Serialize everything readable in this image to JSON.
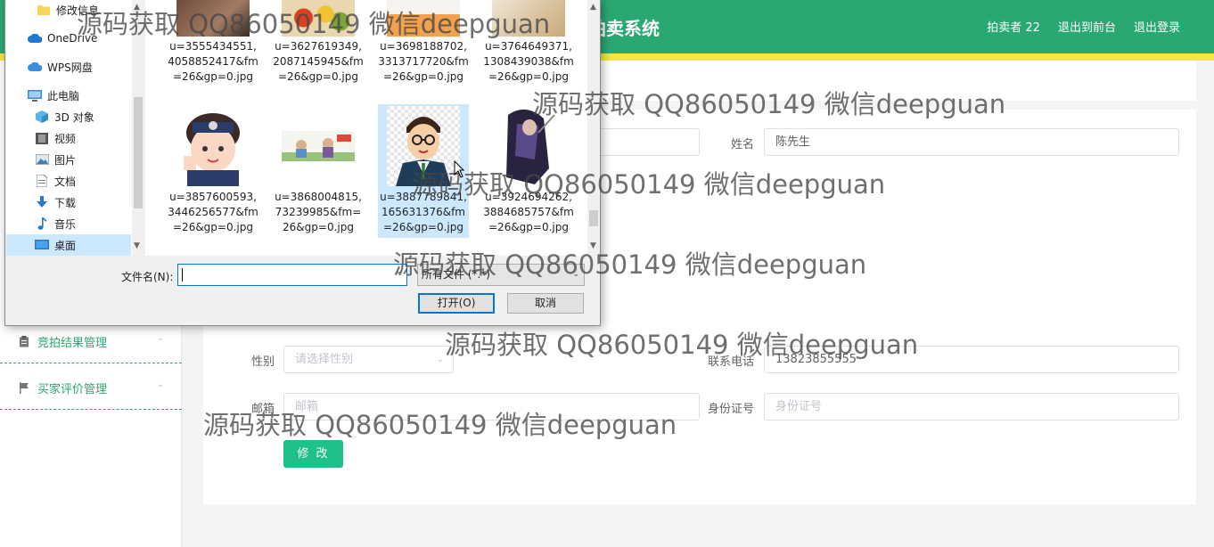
{
  "topbar": {
    "title": "拍卖系统",
    "nav": [
      "拍卖者 22",
      "退出到前台",
      "退出登录"
    ]
  },
  "sidebar": {
    "items": [
      {
        "label": "竞拍结果管理",
        "icon": "clipboard-icon"
      },
      {
        "label": "买家评价管理",
        "icon": "flag-icon"
      }
    ]
  },
  "form": {
    "name_label": "姓名",
    "name_value": "陈先生",
    "gender_label": "性别",
    "gender_placeholder": "请选择性别",
    "phone_label": "联系电话",
    "phone_value": "13823855555",
    "email_label": "邮箱",
    "email_placeholder": "邮箱",
    "idcard_label": "身份证号",
    "idcard_placeholder": "身份证号",
    "submit_label": "修 改"
  },
  "dialog": {
    "nav_items": [
      {
        "label": "修改信息",
        "icon": "folder-icon"
      },
      {
        "label": "OneDrive",
        "icon": "cloud-icon"
      },
      {
        "label": "WPS网盘",
        "icon": "cloud-icon"
      },
      {
        "label": "此电脑",
        "icon": "computer-icon"
      },
      {
        "label": "3D 对象",
        "icon": "cube-icon"
      },
      {
        "label": "视频",
        "icon": "video-icon"
      },
      {
        "label": "图片",
        "icon": "picture-icon"
      },
      {
        "label": "文档",
        "icon": "document-icon"
      },
      {
        "label": "下载",
        "icon": "download-icon"
      },
      {
        "label": "音乐",
        "icon": "music-icon"
      },
      {
        "label": "桌面",
        "icon": "desktop-icon"
      }
    ],
    "files_row1": [
      "u=3555434551,4058852417&fm=26&gp=0.jpg",
      "u=3627619349,2087145945&fm=26&gp=0.jpg",
      "u=3698188702,3313717720&fm=26&gp=0.jpg",
      "u=3764649371,1308439038&fm=26&gp=0.jpg"
    ],
    "files_row2": [
      "u=3857600593,3446256577&fm=26&gp=0.jpg",
      "u=3868004815,73239985&fm=26&gp=0.jpg",
      "u=3887789841,165631376&fm=26&gp=0.jpg",
      "u=3924694262,3884685757&fm=26&gp=0.jpg"
    ],
    "filename_label": "文件名(N):",
    "filename_value": "",
    "filetype": "所有文件 (*.*)",
    "open_label": "打开(O)",
    "cancel_label": "取消"
  },
  "watermark": "源码获取 QQ86050149 微信deepguan"
}
